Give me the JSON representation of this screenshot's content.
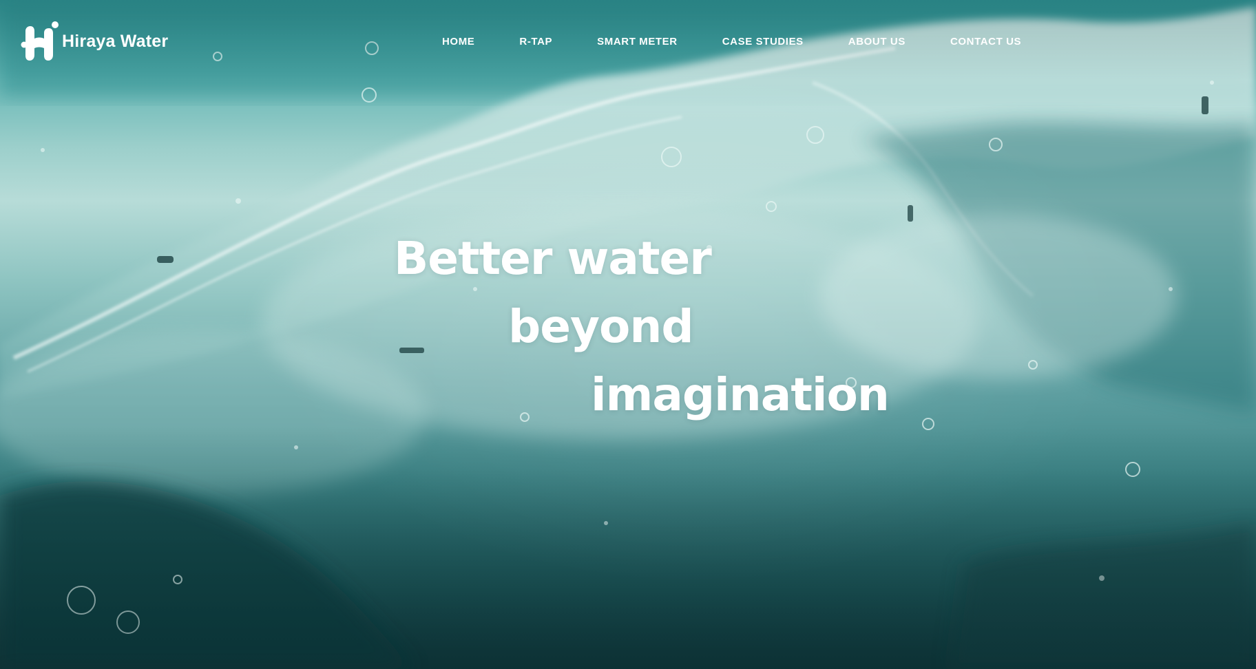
{
  "brand": {
    "name": "Hiraya Water",
    "logo_icon": "hiraya-h-logo-icon"
  },
  "nav": {
    "items": [
      {
        "label": "HOME"
      },
      {
        "label": "R-TAP"
      },
      {
        "label": "SMART METER"
      },
      {
        "label": "CASE STUDIES"
      },
      {
        "label": "ABOUT US"
      },
      {
        "label": "CONTACT US"
      }
    ]
  },
  "hero": {
    "headline": {
      "line_1": "Better water",
      "line_2": "beyond",
      "line_3": "imagination"
    },
    "background": "water-splash-photo"
  },
  "colors": {
    "text": "#ffffff",
    "water_teal": "#3a9fa0",
    "water_deep": "#163f43"
  }
}
